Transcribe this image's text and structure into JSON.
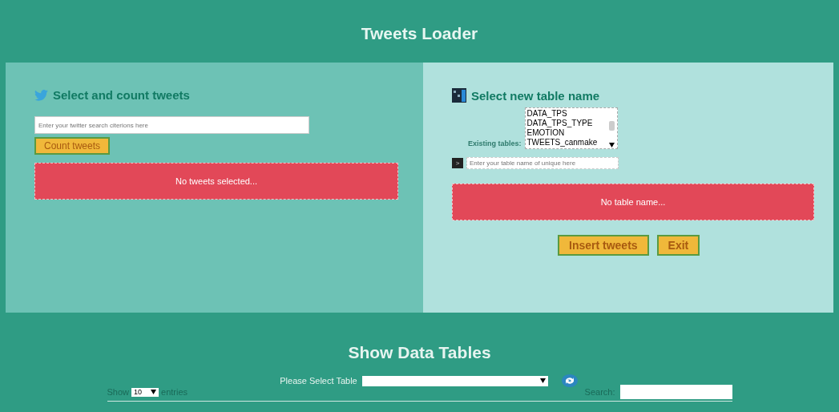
{
  "header": {
    "title": "Tweets Loader"
  },
  "count_panel": {
    "title": "Select and count tweets",
    "search": {
      "placeholder": "Enter your twitter search citerions here"
    },
    "button": "Count tweets",
    "message": "No tweets selected..."
  },
  "table_panel": {
    "title": "Select new table name",
    "existing_label": "Existing tables:",
    "existing_tables": [
      {
        "name": "DATA_TPS"
      },
      {
        "name": "DATA_TPS_TYPE"
      },
      {
        "name": "EMOTION"
      },
      {
        "name": "TWEETS_canmake"
      }
    ],
    "prompt": ">",
    "name_field": {
      "placeholder": "Enter your table name of unique here"
    },
    "message": "No table name...",
    "buttons": [
      "Insert tweets",
      "Exit"
    ]
  },
  "data_tables": {
    "title": "Show Data Tables",
    "select_label": "Please Select Table",
    "show_label": "Show",
    "page_size": "10",
    "entries_label": "entries",
    "search_label": "Search:"
  }
}
